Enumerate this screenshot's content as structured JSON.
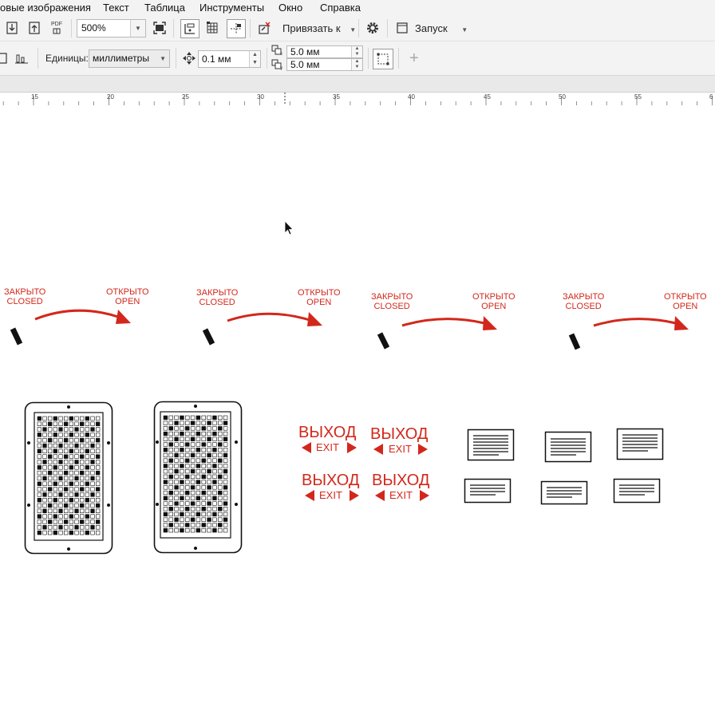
{
  "menu": [
    "овые изображения",
    "Текст",
    "Таблица",
    "Инструменты",
    "Окно",
    "Справка"
  ],
  "toolbar": {
    "pdf_label": "PDF",
    "zoom_value": "500%",
    "snap_label": "Привязать к",
    "launch_label": "Запуск"
  },
  "props": {
    "units_label": "Единицы:",
    "units_value": "миллиметры",
    "nudge_value": "0.1 мм",
    "dup_x": "5.0 мм",
    "dup_y": "5.0 мм"
  },
  "ruler": {
    "labels": [
      "15",
      "20",
      "25",
      "30",
      "35",
      "40",
      "45",
      "50",
      "55",
      "6"
    ]
  },
  "canvas": {
    "valve_diagrams": [
      {
        "closed_ru": "ЗАКРЫТО",
        "closed_en": "CLOSED",
        "open_ru": "ОТКРЫТО",
        "open_en": "OPEN"
      },
      {
        "closed_ru": "ЗАКРЫТО",
        "closed_en": "CLOSED",
        "open_ru": "ОТКРЫТО",
        "open_en": "OPEN"
      },
      {
        "closed_ru": "ЗАКРЫТО",
        "closed_en": "CLOSED",
        "open_ru": "ОТКРЫТО",
        "open_en": "OPEN"
      },
      {
        "closed_ru": "ЗАКРЫТО",
        "closed_en": "CLOSED",
        "open_ru": "ОТКРЫТО",
        "open_en": "OPEN"
      }
    ],
    "exit_signs": [
      {
        "main": "ВЫХОД",
        "sub": "EXIT"
      },
      {
        "main": "ВЫХОД",
        "sub": "EXIT"
      },
      {
        "main": "ВЫХОД",
        "sub": "EXIT"
      },
      {
        "main": "ВЫХОД",
        "sub": "EXIT"
      }
    ],
    "accent_color": "#d2281c",
    "selection_color": "#1e9bd7"
  }
}
